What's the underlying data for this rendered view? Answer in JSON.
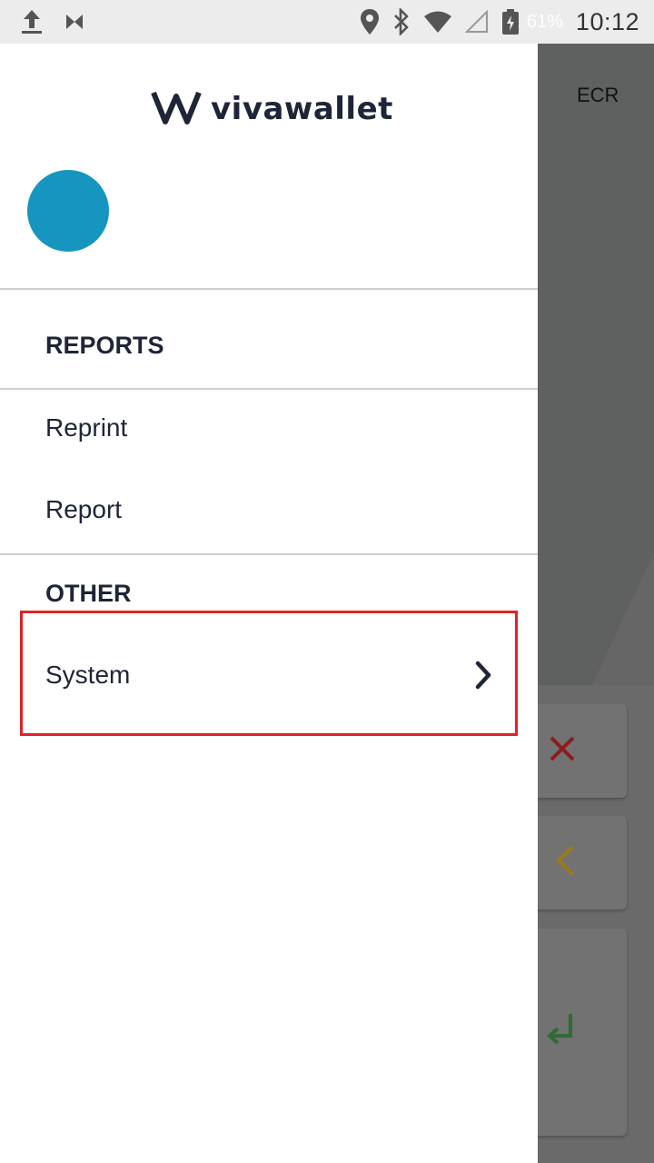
{
  "status_bar": {
    "battery_percent": "61%",
    "time": "10:12"
  },
  "background_app": {
    "ecr_label": "ECR"
  },
  "drawer": {
    "logo_text": "vivawallet",
    "sections": [
      {
        "title": "REPORTS",
        "items": [
          {
            "label": "Reprint"
          },
          {
            "label": "Report"
          }
        ]
      },
      {
        "title": "OTHER",
        "items": [
          {
            "label": "System",
            "icon": "chevron-right-icon"
          }
        ]
      }
    ]
  },
  "colors": {
    "avatar": "#1595c0",
    "brand_text": "#1f2537",
    "highlight_border": "#e02227",
    "scrim": "#5f6060"
  }
}
